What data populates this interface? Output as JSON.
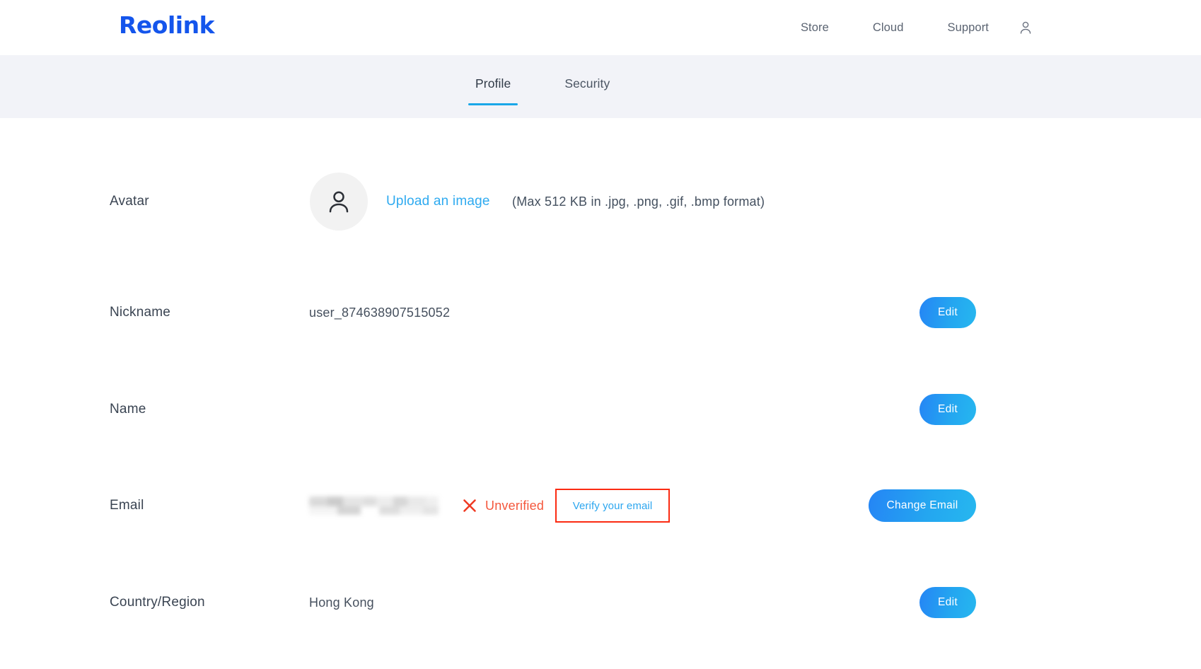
{
  "header": {
    "brand": "Reolink",
    "nav": [
      {
        "label": "Store"
      },
      {
        "label": "Cloud"
      },
      {
        "label": "Support"
      }
    ],
    "account_icon": "user-account-icon"
  },
  "tabs": [
    {
      "label": "Profile",
      "active": true
    },
    {
      "label": "Security",
      "active": false
    }
  ],
  "profile": {
    "avatar": {
      "label": "Avatar",
      "icon": "user-avatar-placeholder-icon",
      "upload_link": "Upload an image",
      "hint": "(Max 512 KB in .jpg, .png, .gif, .bmp format)"
    },
    "nickname": {
      "label": "Nickname",
      "value": "user_874638907515052",
      "button": "Edit"
    },
    "name": {
      "label": "Name",
      "value": "",
      "button": "Edit"
    },
    "email": {
      "label": "Email",
      "value": "",
      "status_icon": "red-x-icon",
      "status": "Unverified",
      "verify_link": "Verify your email",
      "button": "Change Email"
    },
    "country": {
      "label": "Country/Region",
      "value": "Hong Kong",
      "button": "Edit"
    }
  },
  "colors": {
    "brand_blue": "#1455ec",
    "accent_cyan": "#1aa7e8",
    "link_blue": "#2eaaf0",
    "error_red": "#f4573c",
    "highlight_red": "#fb2b12",
    "tabband_bg": "#f2f3f8"
  }
}
